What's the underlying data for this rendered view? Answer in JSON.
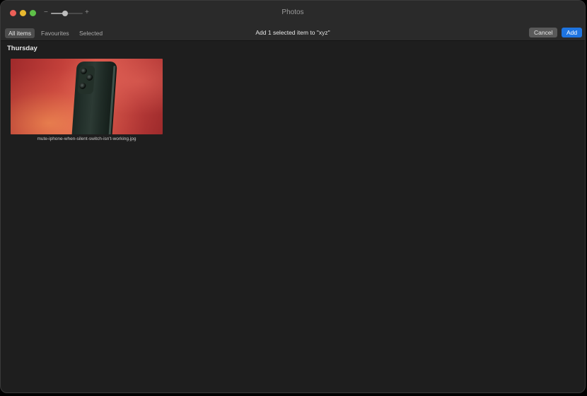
{
  "window": {
    "title": "Photos",
    "zoom_level": 0.45
  },
  "toolbar": {
    "tabs": [
      {
        "label": "All items",
        "active": true
      },
      {
        "label": "Favourites",
        "active": false
      },
      {
        "label": "Selected",
        "active": false
      }
    ],
    "prompt": "Add 1 selected item to \"xyz\"",
    "cancel_label": "Cancel",
    "add_label": "Add",
    "zoom_minus": "−",
    "zoom_plus": "+"
  },
  "content": {
    "section_title": "Thursday",
    "items": [
      {
        "filename": "mute-iphone-when-silent-switch-isn't-working.jpg",
        "selected": true
      }
    ]
  },
  "colors": {
    "accent": "#1e74e0",
    "background": "#1e1e1e",
    "titlebar": "#2a2a2a"
  },
  "icons": {
    "selected_check": "checkmark-circle-icon"
  }
}
